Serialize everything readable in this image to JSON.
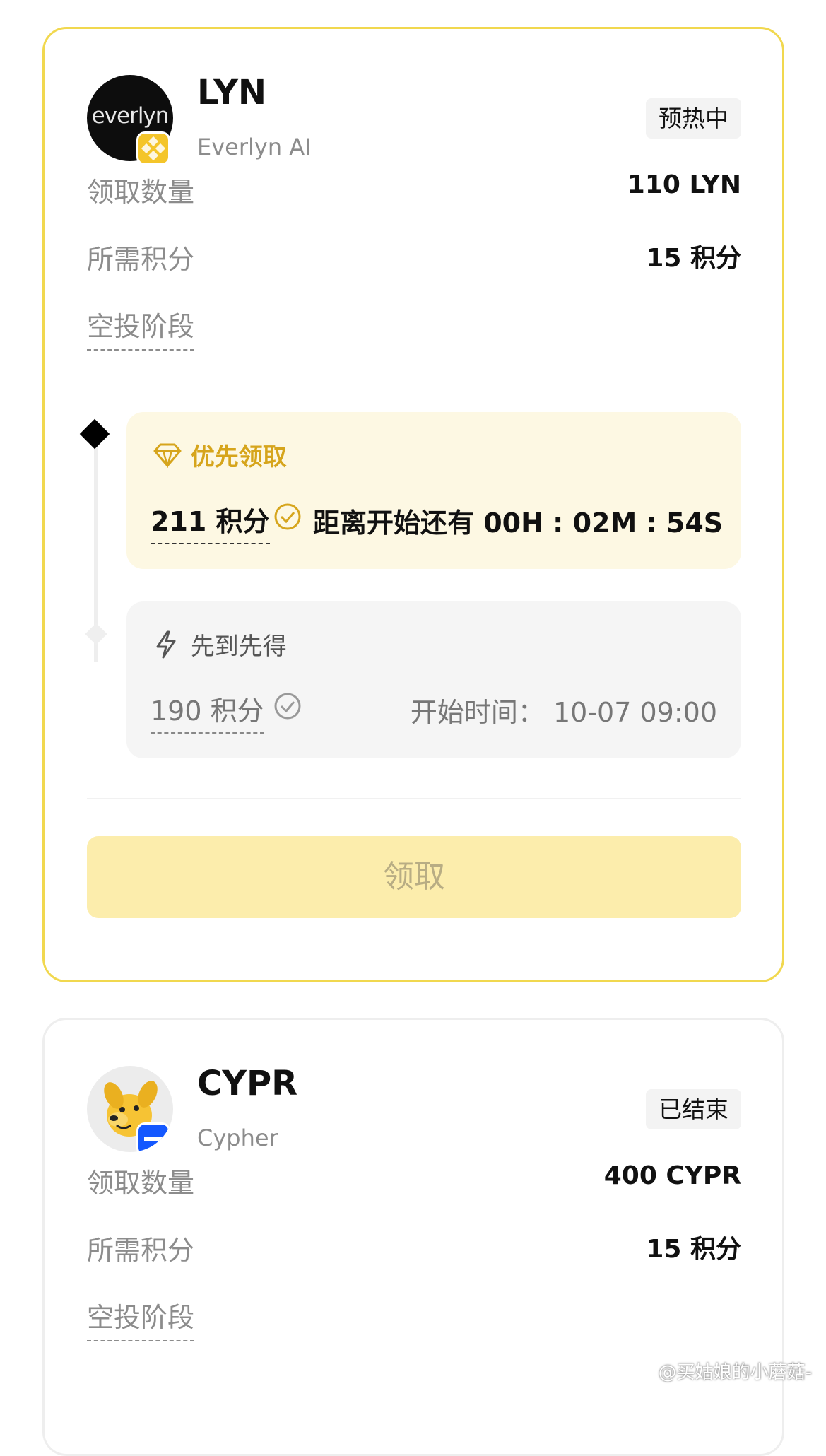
{
  "cards": [
    {
      "title": "LYN",
      "subtitle": "Everlyn AI",
      "logo_text": "everlyn",
      "status": "预热中",
      "claim_amount_label": "领取数量",
      "claim_amount_value": "110 LYN",
      "required_points_label": "所需积分",
      "required_points_value": "15 积分",
      "phase_label": "空投阶段",
      "stages": [
        {
          "title": "优先领取",
          "points": "211 积分",
          "info": "距离开始还有 00H : 02M : 54S",
          "icon": "diamond-icon"
        },
        {
          "title": "先到先得",
          "points": "190 积分",
          "info": "开始时间：  10-07 09:00",
          "icon": "lightning-icon"
        }
      ],
      "claim_button": "领取"
    },
    {
      "title": "CYPR",
      "subtitle": "Cypher",
      "status": "已结束",
      "claim_amount_label": "领取数量",
      "claim_amount_value": "400 CYPR",
      "required_points_label": "所需积分",
      "required_points_value": "15 积分",
      "phase_label": "空投阶段"
    }
  ],
  "watermark": "@买姑娘的小蘑菇-",
  "colors": {
    "accent": "#f1d84f",
    "claim_bg": "#fcedac",
    "stage1_bg": "#fdf8e3",
    "gold_text": "#d6a51c"
  }
}
